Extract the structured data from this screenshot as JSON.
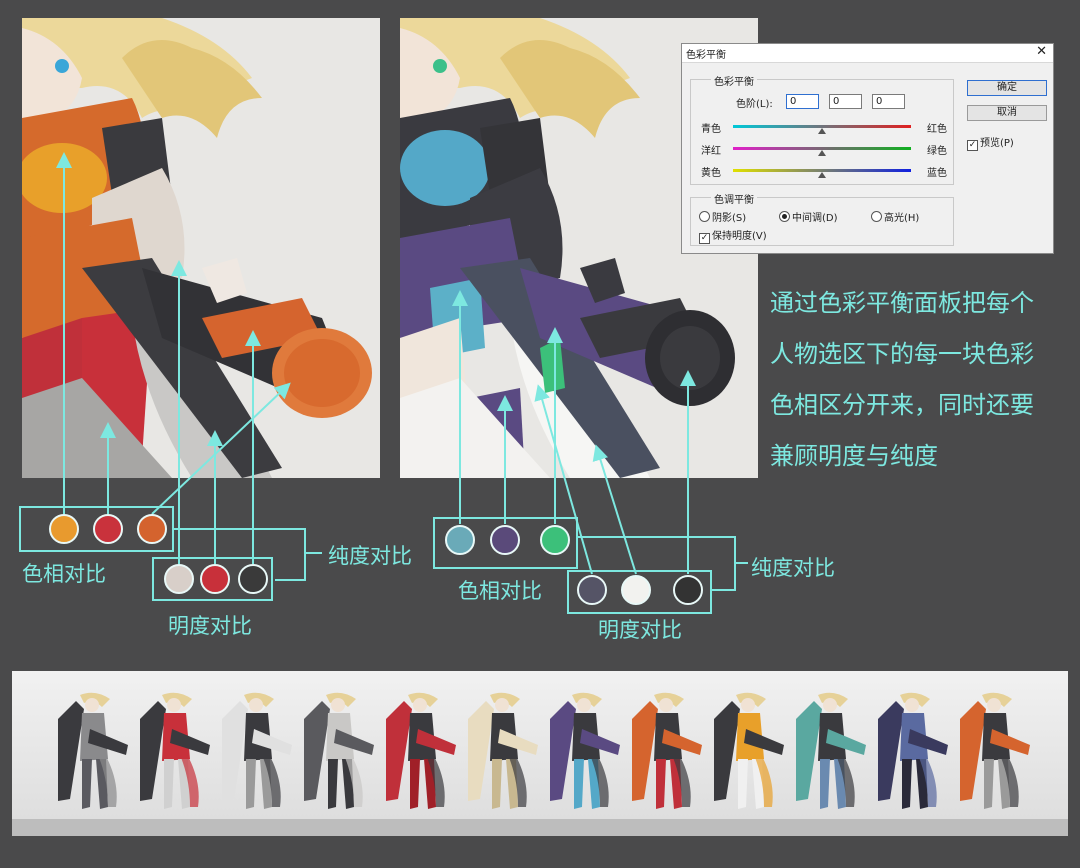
{
  "dialog": {
    "title": "色彩平衡",
    "close": "✕",
    "color_group": "色彩平衡",
    "levels_label": "色阶(L):",
    "levels": [
      "0",
      "0",
      "0"
    ],
    "sliders": [
      {
        "left": "青色",
        "right": "红色",
        "gradient": [
          "#00c8d8",
          "#e02020"
        ]
      },
      {
        "left": "洋红",
        "right": "绿色",
        "gradient": [
          "#e020c8",
          "#10b020"
        ]
      },
      {
        "left": "黄色",
        "right": "蓝色",
        "gradient": [
          "#e0e000",
          "#1020e0"
        ]
      }
    ],
    "tone_group": "色调平衡",
    "tone_options": [
      "阴影(S)",
      "中间调(D)",
      "高光(H)"
    ],
    "tone_selected": "中间调(D)",
    "preserve_luminosity": "保持明度(V)",
    "ok": "确定",
    "cancel": "取消",
    "preview": "预览(P)"
  },
  "caption": [
    "通过色彩平衡面板把每个",
    "人物选区下的每一块色彩",
    "色相区分开来，同时还要",
    "兼顾明度与纯度"
  ],
  "labels": {
    "left_hue": "色相对比",
    "left_saturation": "纯度对比",
    "left_value": "明度对比",
    "right_hue": "色相对比",
    "right_saturation": "纯度对比",
    "right_value": "明度对比"
  },
  "swatches": {
    "left_hue": [
      "#e89a2e",
      "#c9323c",
      "#d4632e"
    ],
    "left_value": [
      "#d8cfc9",
      "#c8303a",
      "#3a3a3a"
    ],
    "right_hue": [
      "#6aaab8",
      "#5a4a7a",
      "#3cc07a"
    ],
    "right_value": [
      "#555466",
      "#f2f2ef",
      "#333333"
    ]
  },
  "colors": {
    "accent": "#7de8e0",
    "background": "#4a4a4b"
  }
}
